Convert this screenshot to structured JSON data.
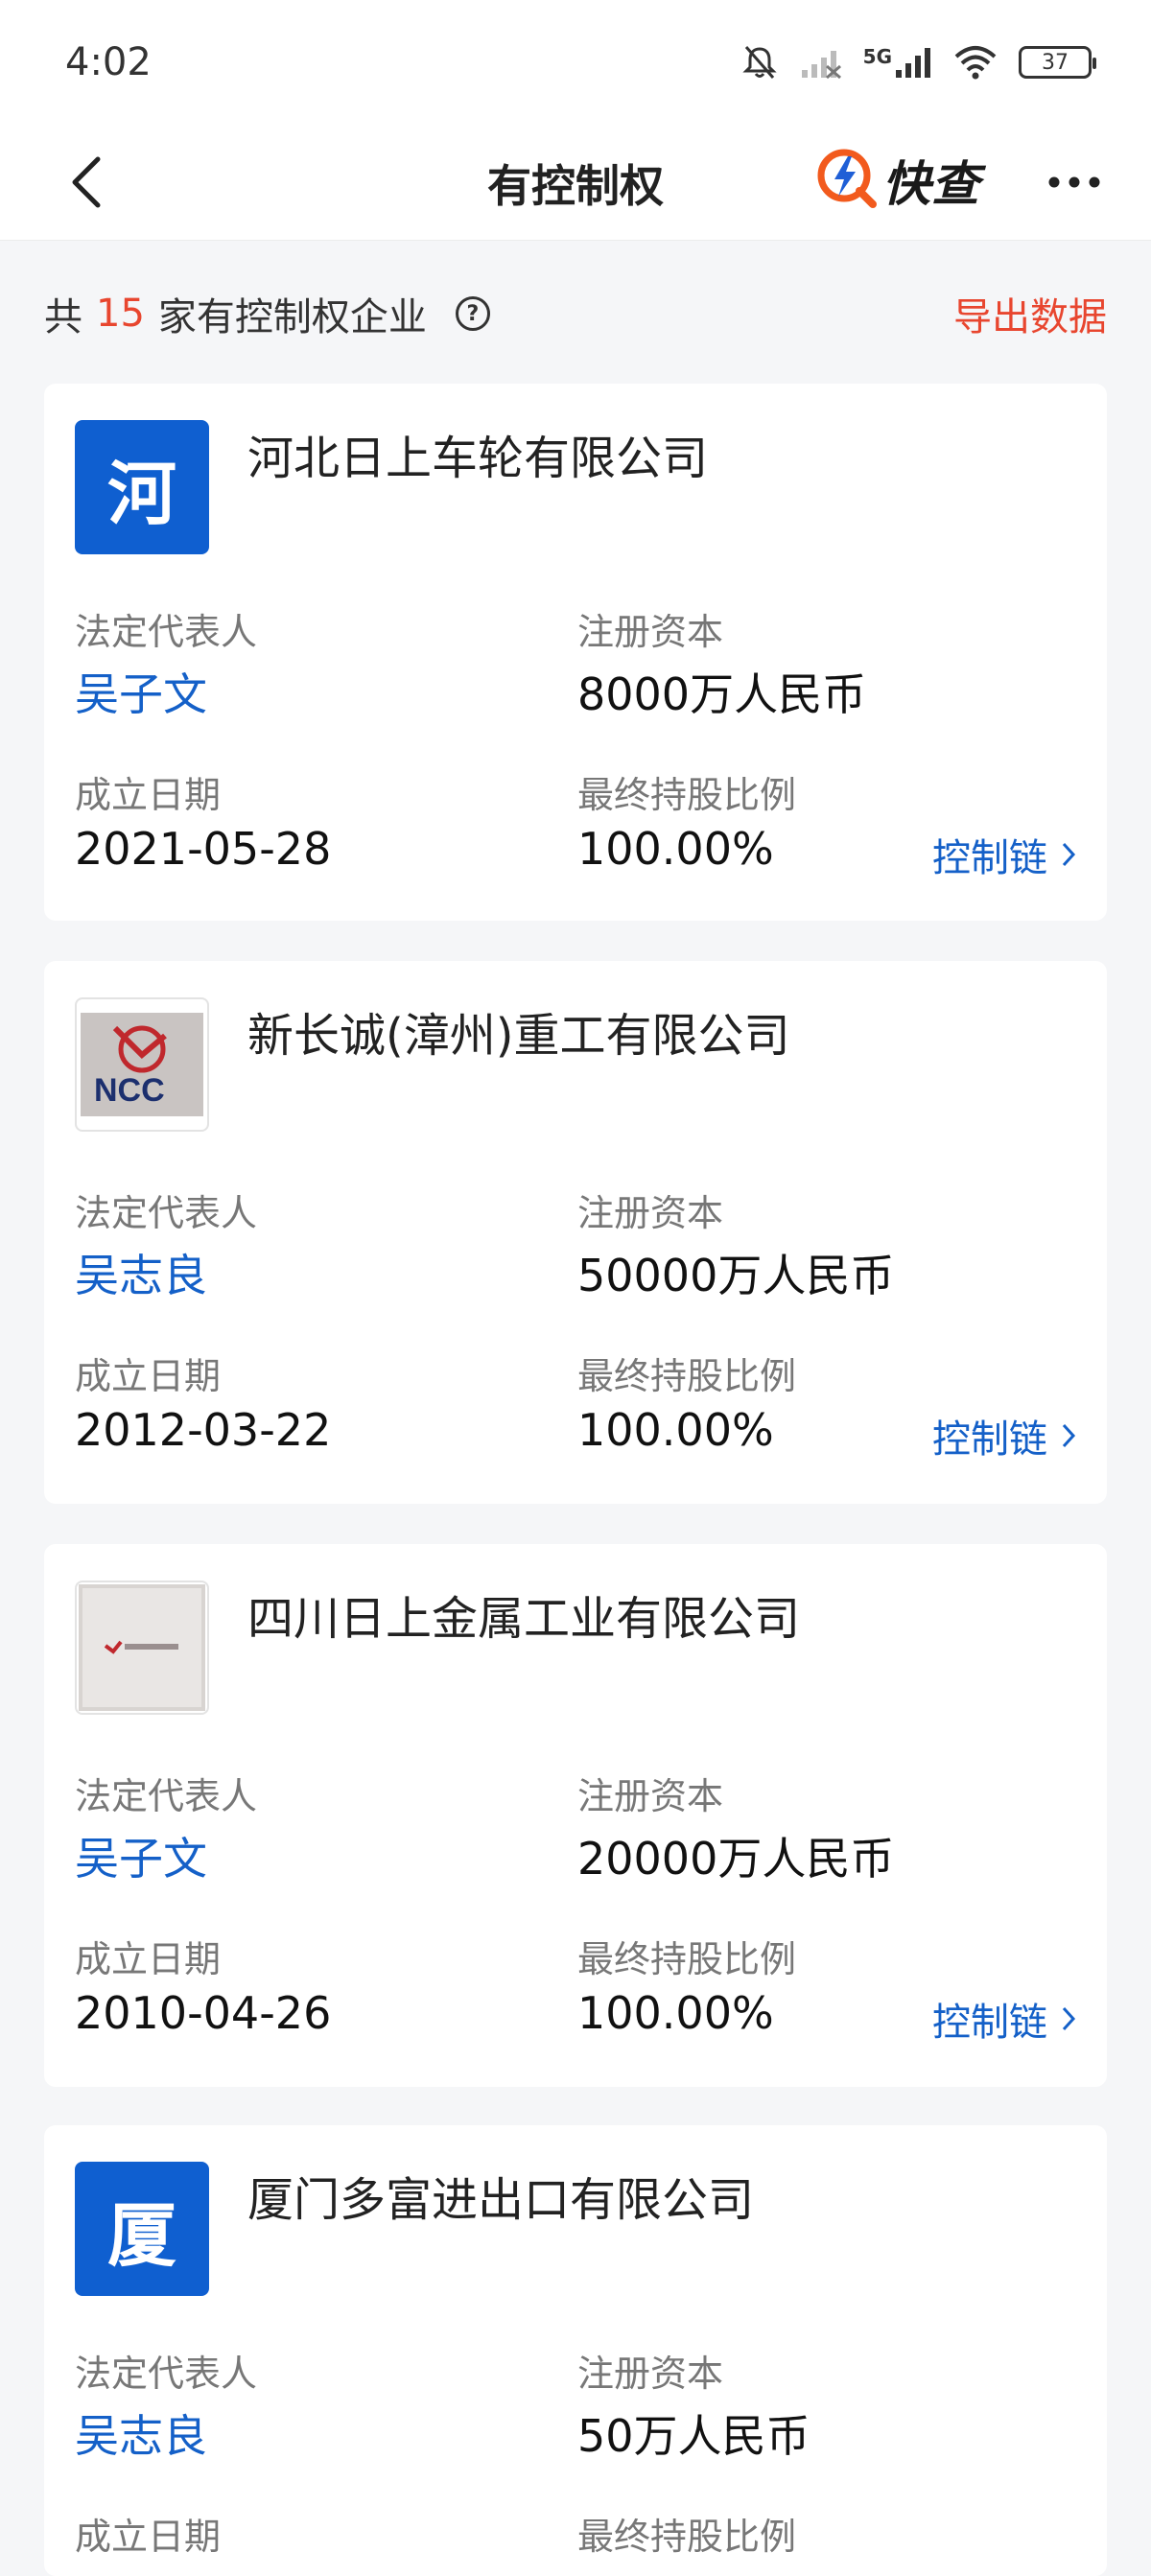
{
  "status_bar": {
    "time": "4:02",
    "network": "5G",
    "battery": "37"
  },
  "nav": {
    "title": "有控制权",
    "brand_name": "快查",
    "accent_color": "#1460c8",
    "brand_color": "#f25a1d"
  },
  "summary": {
    "prefix": "共",
    "count": "15",
    "suffix": "家有控制权企业",
    "export_label": "导出数据",
    "highlight_color": "#e8462f"
  },
  "labels": {
    "legal_rep": "法定代表人",
    "registered_capital": "注册资本",
    "established_date": "成立日期",
    "final_holding_ratio": "最终持股比例",
    "control_chain": "控制链"
  },
  "companies": [
    {
      "logo_text": "河",
      "logo_type": "letter",
      "name": "河北日上车轮有限公司",
      "legal_rep": "吴子文",
      "registered_capital": "8000万人民币",
      "established_date": "2021-05-28",
      "holding_ratio": "100.00%"
    },
    {
      "logo_text": "NCC",
      "logo_type": "image",
      "name": "新长诚(漳州)重工有限公司",
      "legal_rep": "吴志良",
      "registered_capital": "50000万人民币",
      "established_date": "2012-03-22",
      "holding_ratio": "100.00%"
    },
    {
      "logo_type": "image",
      "name": "四川日上金属工业有限公司",
      "legal_rep": "吴子文",
      "registered_capital": "20000万人民币",
      "established_date": "2010-04-26",
      "holding_ratio": "100.00%"
    },
    {
      "logo_text": "厦",
      "logo_type": "letter",
      "name": "厦门多富进出口有限公司",
      "legal_rep": "吴志良",
      "registered_capital": "50万人民币",
      "established_date": "",
      "holding_ratio": ""
    }
  ]
}
